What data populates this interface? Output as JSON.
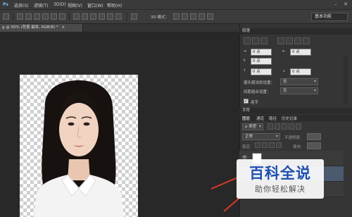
{
  "menu": {
    "logo": "Ps",
    "items": [
      "选择(S)",
      "滤镜(T)",
      "3D(D)",
      "视图(V)",
      "窗口(W)",
      "帮助(H)"
    ],
    "minimize": "–",
    "close": "✕"
  },
  "options": {
    "mode_3d_label": "3D 模式：",
    "workspace": "基本功能"
  },
  "document": {
    "tab_label": "g @ 50% (背景 副本, RGB/8) *",
    "tab_close": "×"
  },
  "paragraph_panel": {
    "title": "段落",
    "indent_left": "0 点",
    "indent_right": "0 点",
    "indent_first": "0 点",
    "space_before": "0 点",
    "space_after": "0 点",
    "kinsoku_label": "避头尾法则设置：",
    "kinsoku_value": "无",
    "composer_label": "间距组合设置：",
    "composer_value": "无",
    "hyphenate_label": "连字"
  },
  "layers_panel": {
    "character_tab": "字符",
    "tabs": [
      "图层",
      "通道",
      "路径",
      "历史记录"
    ],
    "filter_kind": "ρ 类型",
    "blend_mode": "正常",
    "opacity_label": "不透明度:",
    "lock_label": "锁定:",
    "fill_label": "填充:"
  },
  "watermark": {
    "title": "百科全说",
    "subtitle": "助你轻松解决"
  },
  "colors": {
    "accent_arrow": "#d63a2a",
    "watermark_blue": "#1e4fb0"
  }
}
